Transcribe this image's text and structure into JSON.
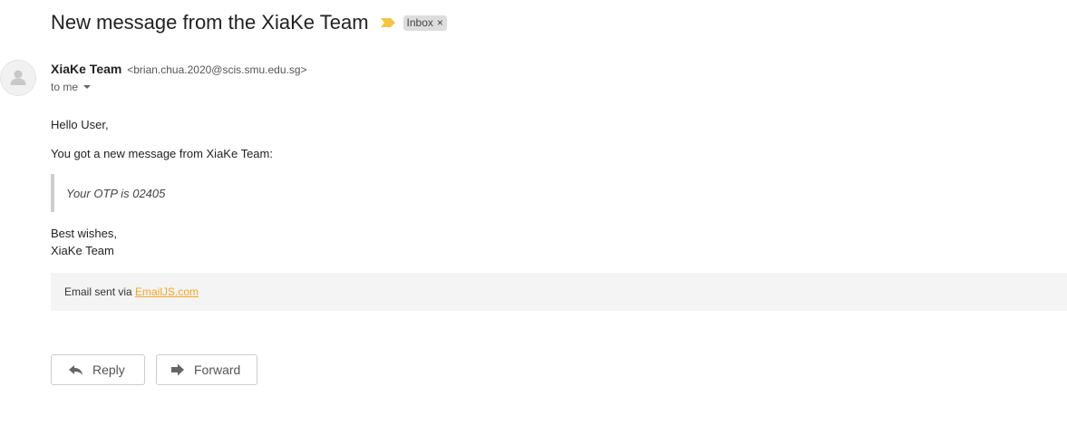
{
  "email": {
    "subject": "New message from the XiaKe Team",
    "label": "Inbox",
    "label_close": "×",
    "sender_name": "XiaKe Team",
    "sender_email": "<brian.chua.2020@scis.smu.edu.sg>",
    "recipient": "to me",
    "greeting": "Hello User,",
    "intro": "You got a new message from XiaKe Team:",
    "quote": "Your OTP is 02405",
    "signoff_line1": "Best wishes,",
    "signoff_line2": "XiaKe Team",
    "footer_prefix": "Email sent via ",
    "footer_link": "EmailJS.com"
  },
  "actions": {
    "reply_label": "Reply",
    "forward_label": "Forward"
  },
  "icons": {
    "importance": "importance-marker-icon",
    "avatar": "person-avatar-icon",
    "reply": "reply-arrow-icon",
    "forward": "forward-arrow-icon",
    "caret": "chevron-down-icon"
  },
  "colors": {
    "importance": "#f4c542",
    "link": "#f5a623",
    "label_bg": "#dddddd"
  }
}
